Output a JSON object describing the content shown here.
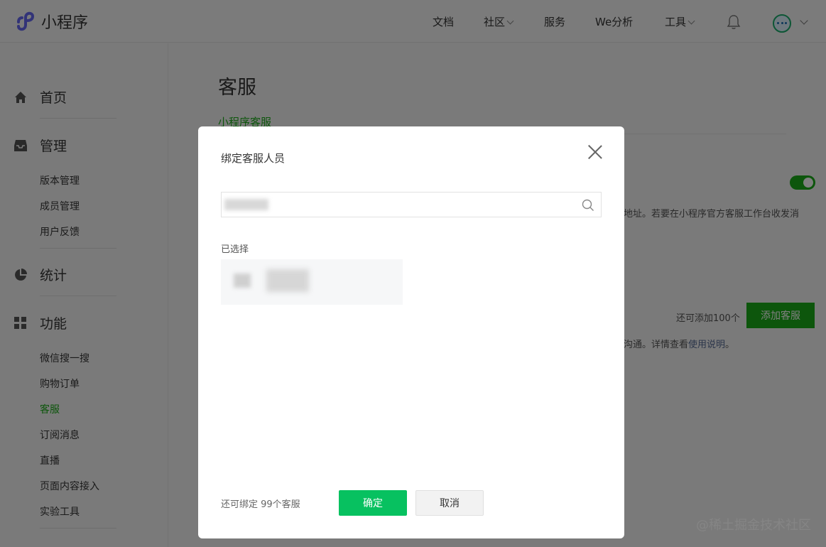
{
  "header": {
    "logo_text": "小程序",
    "nav": [
      {
        "label": "文档",
        "has_menu": false
      },
      {
        "label": "社区",
        "has_menu": true
      },
      {
        "label": "服务",
        "has_menu": false
      },
      {
        "label": "We分析",
        "has_menu": false
      },
      {
        "label": "工具",
        "has_menu": true
      }
    ]
  },
  "sidebar": {
    "groups": [
      {
        "label": "首页",
        "icon": "home-icon",
        "items": []
      },
      {
        "label": "管理",
        "icon": "inbox-icon",
        "items": [
          "版本管理",
          "成员管理",
          "用户反馈"
        ]
      },
      {
        "label": "统计",
        "icon": "pie-chart-icon",
        "items": []
      },
      {
        "label": "功能",
        "icon": "grid-icon",
        "items": [
          "微信搜一搜",
          "购物订单",
          "客服",
          "订阅消息",
          "直播",
          "页面内容接入",
          "实验工具"
        ]
      }
    ],
    "active_item": "客服"
  },
  "main": {
    "page_title": "客服",
    "subtab": "小程序客服",
    "desc_tail": "地址。若要在小程序官方客服工作台收发消",
    "quota_text": "还可添加100个",
    "add_button": "添加客服",
    "guide_prefix": "沟通。详情查看",
    "guide_link": "使用说明",
    "guide_suffix": "。"
  },
  "dialog": {
    "title": "绑定客服人员",
    "selected_label": "已选择",
    "footer_text": "还可绑定 99个客服",
    "confirm_label": "确定",
    "cancel_label": "取消"
  },
  "watermark": "@稀土掘金技术社区",
  "colors": {
    "brand_green": "#1aad19",
    "confirm_green": "#07c160",
    "link_blue": "#576b95"
  }
}
